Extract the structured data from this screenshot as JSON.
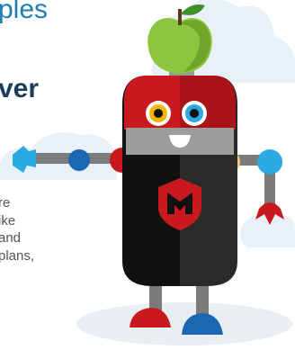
{
  "heading": {
    "line1": "ples",
    "line2": "ver"
  },
  "paragraph": {
    "lines": [
      "re",
      "ike",
      "and",
      "plans,"
    ]
  },
  "colors": {
    "heading_blue": "#1f7fb0",
    "heading_dark": "#1a3d5c",
    "robot_red": "#c8191e",
    "robot_black": "#1a1a1a",
    "apple_green": "#8cc63f",
    "cloud": "#e8f1f8"
  }
}
